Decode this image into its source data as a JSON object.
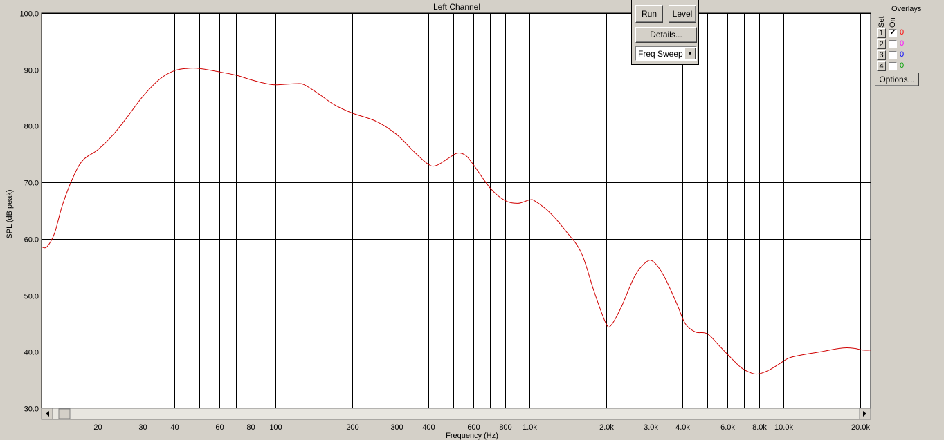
{
  "chart_data": {
    "type": "line",
    "title": "Left Channel",
    "xlabel": "Frequency (Hz)",
    "ylabel": "SPL (dB peak)",
    "x_scale": "log",
    "xlim": [
      12,
      22000
    ],
    "ylim": [
      30,
      100
    ],
    "grid": true,
    "yticks": [
      {
        "v": 100,
        "label": "100.0"
      },
      {
        "v": 90,
        "label": "90.0"
      },
      {
        "v": 80,
        "label": "80.0"
      },
      {
        "v": 70,
        "label": "70.0"
      },
      {
        "v": 60,
        "label": "60.0"
      },
      {
        "v": 50,
        "label": "50.0"
      },
      {
        "v": 40,
        "label": "40.0"
      },
      {
        "v": 30,
        "label": "30.0"
      }
    ],
    "xticks": [
      {
        "v": 20,
        "label": "20"
      },
      {
        "v": 30,
        "label": "30"
      },
      {
        "v": 40,
        "label": "40"
      },
      {
        "v": 50,
        "label": ""
      },
      {
        "v": 60,
        "label": "60"
      },
      {
        "v": 70,
        "label": ""
      },
      {
        "v": 80,
        "label": "80"
      },
      {
        "v": 90,
        "label": ""
      },
      {
        "v": 100,
        "label": "100"
      },
      {
        "v": 200,
        "label": "200"
      },
      {
        "v": 300,
        "label": "300"
      },
      {
        "v": 400,
        "label": "400"
      },
      {
        "v": 500,
        "label": ""
      },
      {
        "v": 600,
        "label": "600"
      },
      {
        "v": 700,
        "label": ""
      },
      {
        "v": 800,
        "label": "800"
      },
      {
        "v": 900,
        "label": ""
      },
      {
        "v": 1000,
        "label": "1.0k"
      },
      {
        "v": 2000,
        "label": "2.0k"
      },
      {
        "v": 3000,
        "label": "3.0k"
      },
      {
        "v": 4000,
        "label": "4.0k"
      },
      {
        "v": 5000,
        "label": ""
      },
      {
        "v": 6000,
        "label": "6.0k"
      },
      {
        "v": 7000,
        "label": ""
      },
      {
        "v": 8000,
        "label": "8.0k"
      },
      {
        "v": 9000,
        "label": ""
      },
      {
        "v": 10000,
        "label": "10.0k"
      },
      {
        "v": 20000,
        "label": "20.0k"
      }
    ],
    "series": [
      {
        "color": "#d00000",
        "points": [
          [
            12,
            58.6
          ],
          [
            12.6,
            58.6
          ],
          [
            13.5,
            61
          ],
          [
            14.5,
            66
          ],
          [
            16,
            71
          ],
          [
            17.5,
            74
          ],
          [
            20,
            75.8
          ],
          [
            23,
            78.5
          ],
          [
            26,
            81.5
          ],
          [
            30,
            85.2
          ],
          [
            35,
            88.3
          ],
          [
            40,
            89.8
          ],
          [
            45,
            90.2
          ],
          [
            50,
            90.2
          ],
          [
            60,
            89.6
          ],
          [
            70,
            89
          ],
          [
            80,
            88.2
          ],
          [
            90,
            87.6
          ],
          [
            100,
            87.3
          ],
          [
            120,
            87.5
          ],
          [
            130,
            87.3
          ],
          [
            150,
            85.5
          ],
          [
            170,
            83.8
          ],
          [
            200,
            82.3
          ],
          [
            250,
            80.8
          ],
          [
            300,
            78.5
          ],
          [
            350,
            75.5
          ],
          [
            400,
            73.2
          ],
          [
            430,
            73
          ],
          [
            480,
            74.3
          ],
          [
            520,
            75.2
          ],
          [
            560,
            74.8
          ],
          [
            600,
            73.2
          ],
          [
            700,
            69
          ],
          [
            800,
            66.8
          ],
          [
            900,
            66.3
          ],
          [
            1000,
            66.9
          ],
          [
            1050,
            66.7
          ],
          [
            1200,
            64.7
          ],
          [
            1400,
            61.2
          ],
          [
            1600,
            57.5
          ],
          [
            1800,
            50.5
          ],
          [
            2000,
            45
          ],
          [
            2100,
            44.8
          ],
          [
            2300,
            48
          ],
          [
            2600,
            53.5
          ],
          [
            2900,
            56
          ],
          [
            3100,
            55.8
          ],
          [
            3400,
            53.2
          ],
          [
            3800,
            48.5
          ],
          [
            4100,
            45
          ],
          [
            4500,
            43.5
          ],
          [
            5000,
            43.2
          ],
          [
            5600,
            41
          ],
          [
            6000,
            39.6
          ],
          [
            6800,
            37.2
          ],
          [
            7500,
            36.2
          ],
          [
            8000,
            36.1
          ],
          [
            8700,
            36.7
          ],
          [
            9500,
            37.7
          ],
          [
            10500,
            38.9
          ],
          [
            12000,
            39.5
          ],
          [
            14000,
            40
          ],
          [
            16000,
            40.5
          ],
          [
            17500,
            40.7
          ],
          [
            19000,
            40.6
          ],
          [
            20500,
            40.3
          ],
          [
            22000,
            40.3
          ]
        ]
      }
    ]
  },
  "panel": {
    "run_label": "Run",
    "level_label": "Level",
    "details_label": "Details...",
    "mode_value": "Freq Sweep"
  },
  "overlays": {
    "title": "Overlays",
    "set_label": "Set",
    "on_label": "On",
    "rows": [
      {
        "set": "1",
        "checked": true,
        "count": "0",
        "color": "#ff0000"
      },
      {
        "set": "2",
        "checked": false,
        "count": "0",
        "color": "#ff00ff"
      },
      {
        "set": "3",
        "checked": false,
        "count": "0",
        "color": "#0000ff"
      },
      {
        "set": "4",
        "checked": false,
        "count": "0",
        "color": "#00a000"
      }
    ],
    "options_label": "Options..."
  }
}
